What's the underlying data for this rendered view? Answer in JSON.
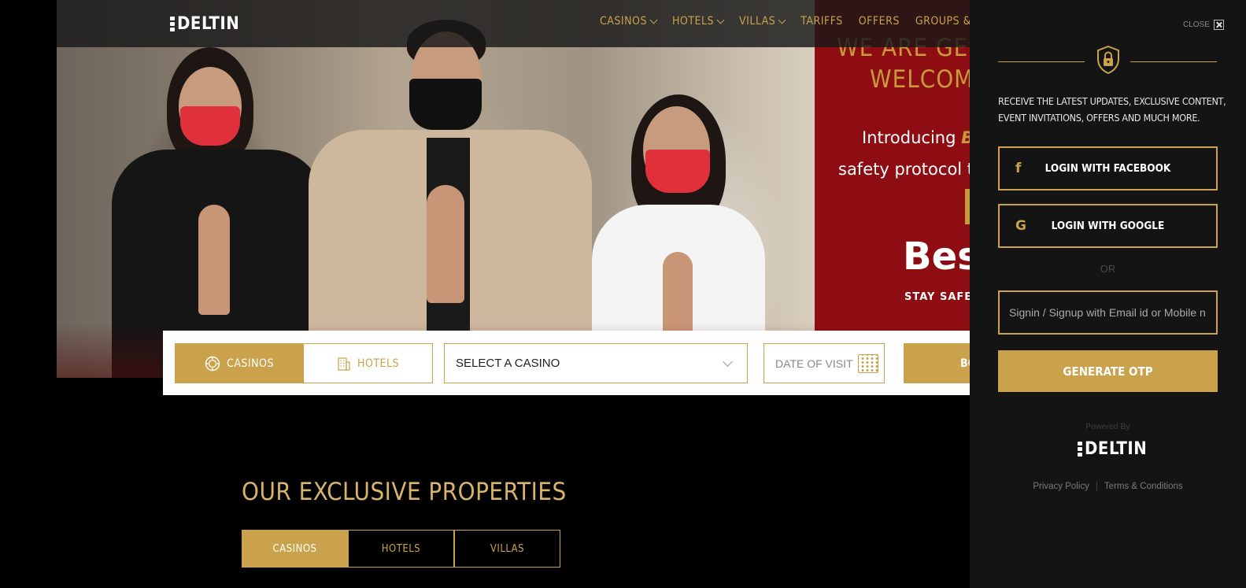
{
  "header": {
    "logo_text": "DELTIN",
    "nav": [
      {
        "label": "CASINOS",
        "has_dropdown": true
      },
      {
        "label": "HOTELS",
        "has_dropdown": true
      },
      {
        "label": "VILLAS",
        "has_dropdown": true
      },
      {
        "label": "TARIFFS",
        "has_dropdown": false
      },
      {
        "label": "OFFERS",
        "has_dropdown": false
      },
      {
        "label": "GROUPS & VE",
        "has_dropdown": false
      }
    ]
  },
  "hero": {
    "headline_1": "WE ARE GE",
    "headline_2": "WELCOM",
    "intro_prefix": "Introducing ",
    "intro_brand": "Bes",
    "safety_line": "safety protocol that",
    "best_text": "Best",
    "stay_safe": "STAY SAFE •"
  },
  "booking": {
    "tabs": [
      {
        "label": "CASINOS",
        "icon": "chip-icon",
        "active": true
      },
      {
        "label": "HOTELS",
        "icon": "building-icon",
        "active": false
      }
    ],
    "select_value": "SELECT A CASINO",
    "date_placeholder": "DATE OF VISIT",
    "book_label": "BO"
  },
  "properties": {
    "title": "OUR EXCLUSIVE PROPERTIES",
    "tabs": [
      {
        "label": "CASINOS",
        "active": true
      },
      {
        "label": "HOTELS",
        "active": false
      },
      {
        "label": "VILLAS",
        "active": false
      }
    ]
  },
  "login_panel": {
    "close_label": "CLOSE",
    "icon": "lock-shield-icon",
    "promo_text": "RECEIVE THE LATEST UPDATES, EXCLUSIVE CONTENT, EVENT INVITATIONS, OFFERS AND MUCH MORE.",
    "facebook_label": "LOGIN WITH FACEBOOK",
    "google_label": "LOGIN WITH GOOGLE",
    "or_label": "OR",
    "input_placeholder": "Signin / Signup with Email id or Mobile n",
    "otp_label": "GENERATE OTP",
    "powered_by": "Powered By",
    "powered_logo": "DELTIN",
    "privacy_label": "Privacy Policy",
    "terms_label": "Terms & Conditions"
  },
  "colors": {
    "gold": "#c9a24b",
    "panel_bg": "#141414",
    "hero_red": "#8e0d12"
  }
}
